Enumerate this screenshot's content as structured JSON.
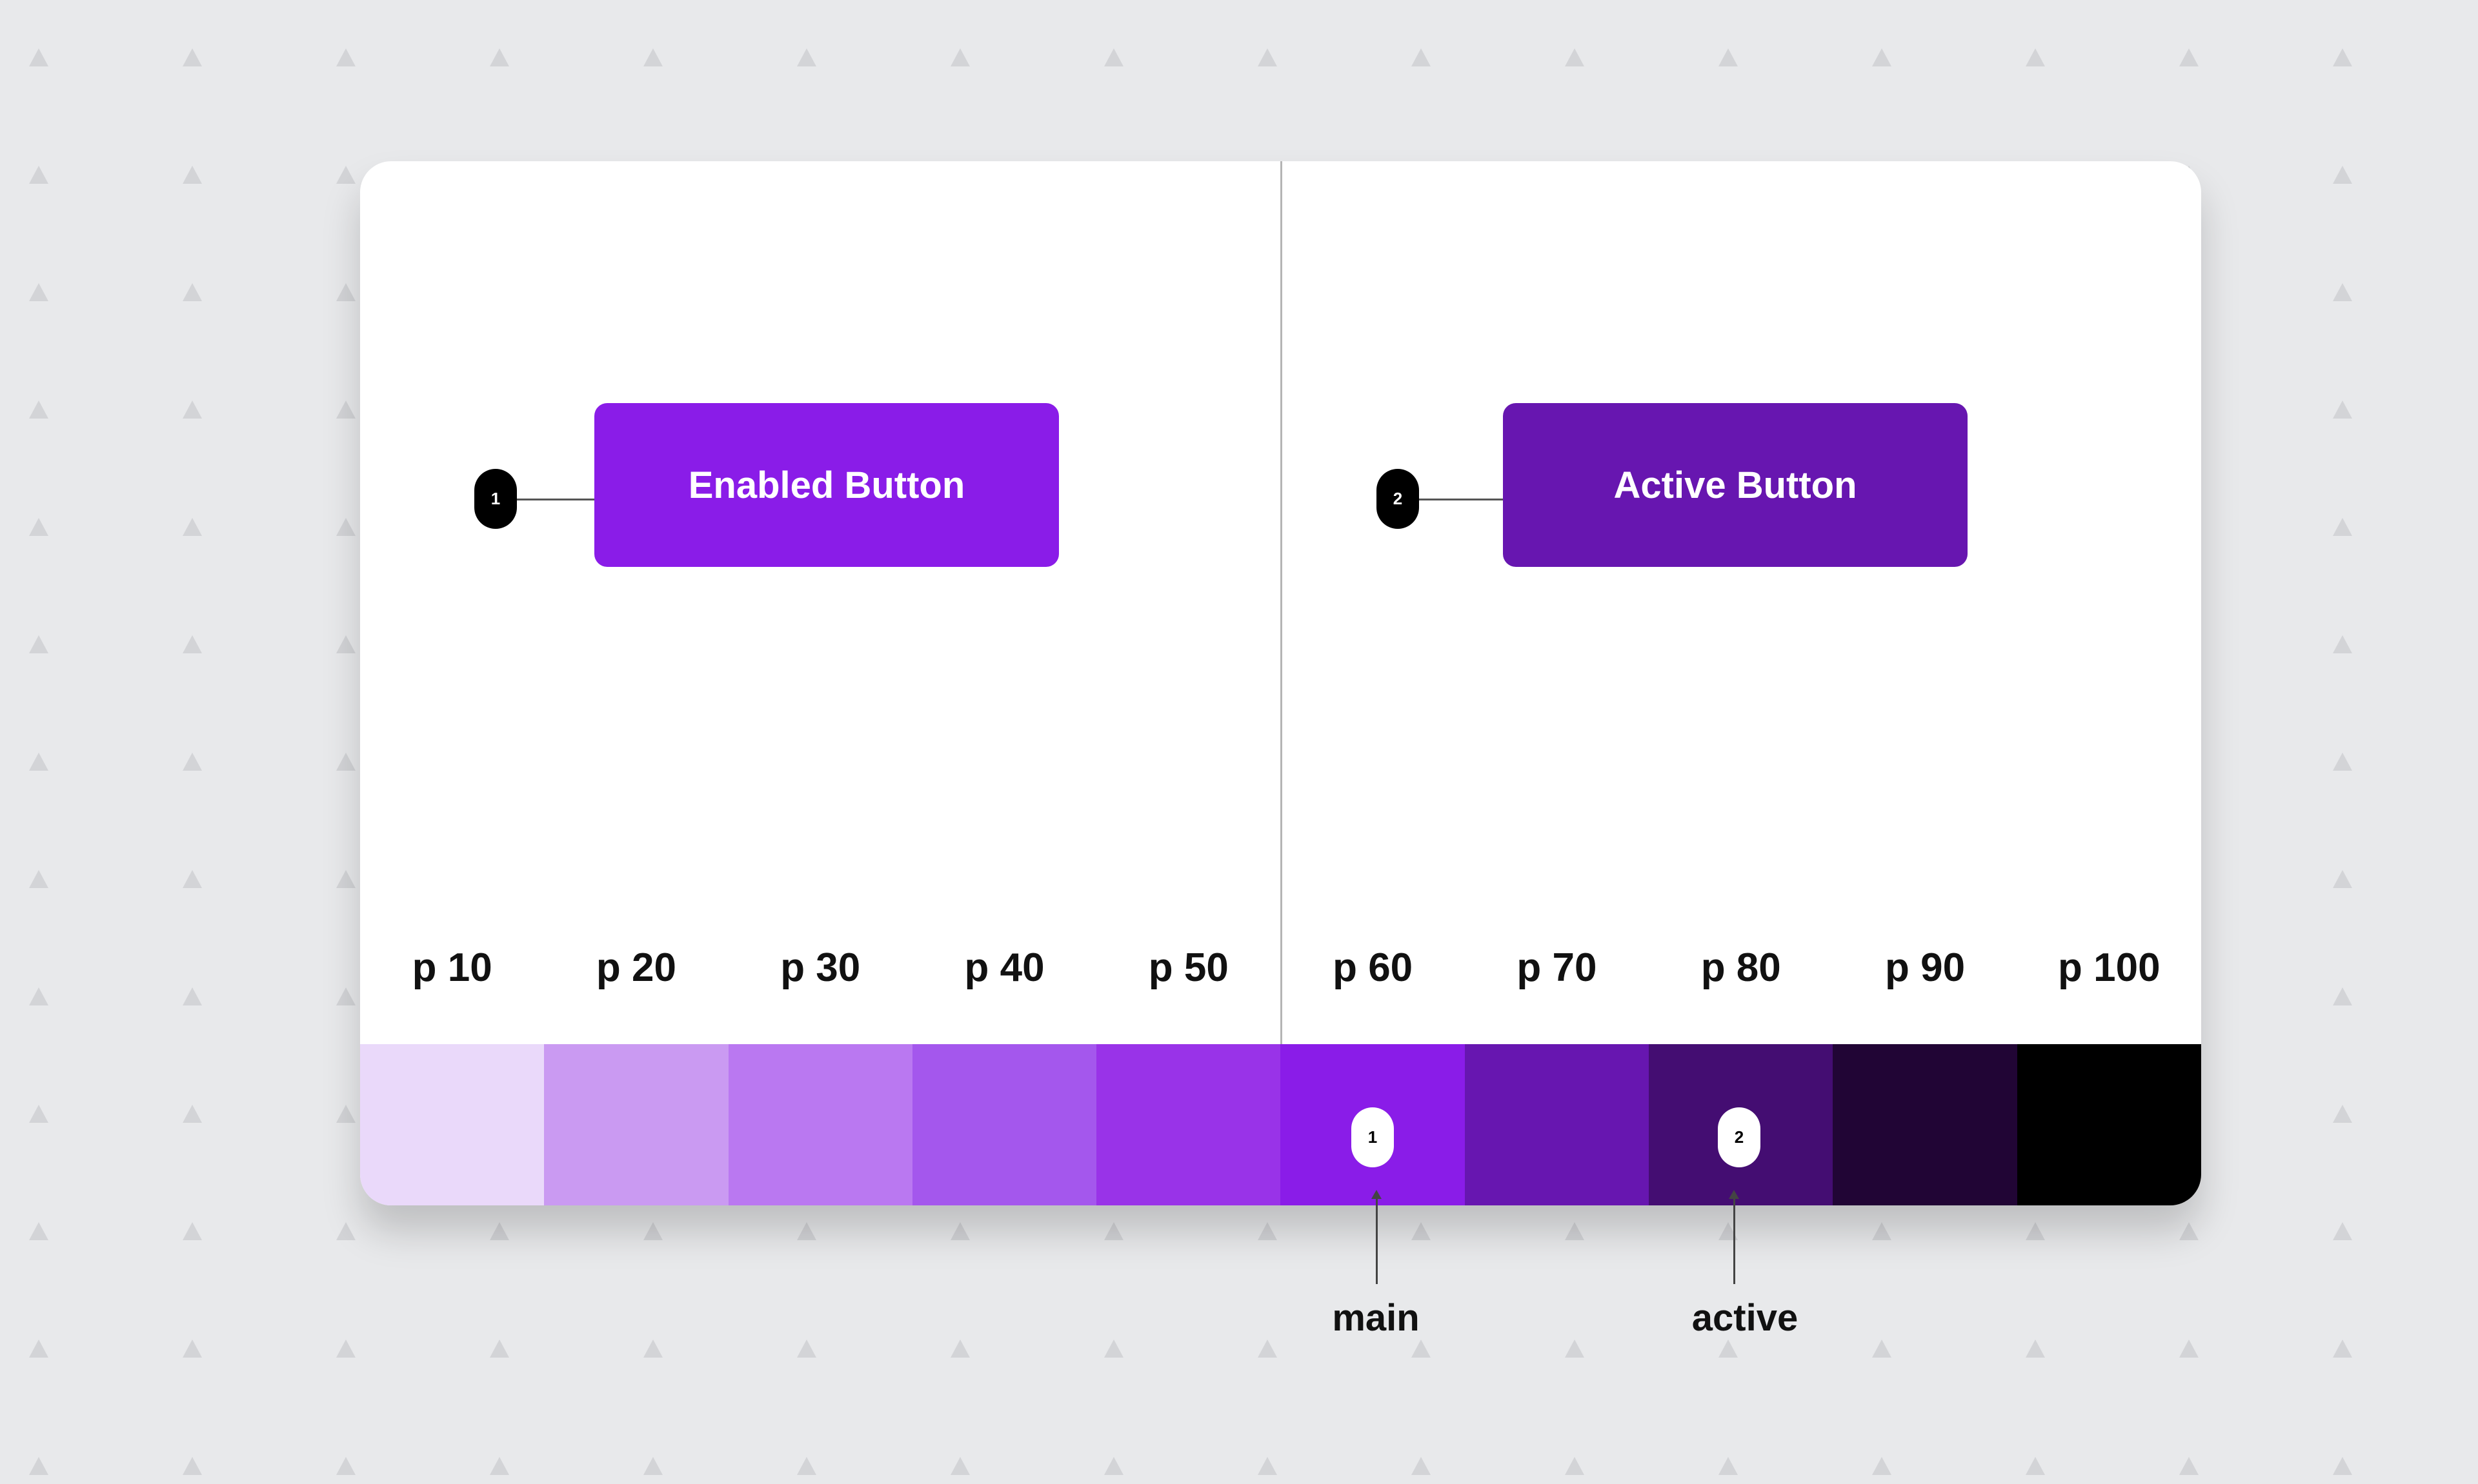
{
  "states": [
    {
      "badge": "1",
      "label": "Enabled Button",
      "color": "#8A1CE8"
    },
    {
      "badge": "2",
      "label": "Active Button",
      "color": "#6716B0"
    }
  ],
  "palette": [
    {
      "label": "p 10",
      "color": "#EAD9FA"
    },
    {
      "label": "p 20",
      "color": "#CA9AF2"
    },
    {
      "label": "p 30",
      "color": "#BA78F1"
    },
    {
      "label": "p 40",
      "color": "#A457ED"
    },
    {
      "label": "p 50",
      "color": "#9933E8"
    },
    {
      "label": "p 60",
      "color": "#8A1CE8"
    },
    {
      "label": "p 70",
      "color": "#6716B0"
    },
    {
      "label": "p 80",
      "color": "#440D72"
    },
    {
      "label": "p 90",
      "color": "#210535"
    },
    {
      "label": "p 100",
      "color": "#000000"
    }
  ],
  "annotations": [
    {
      "badge": "1",
      "label": "main"
    },
    {
      "badge": "2",
      "label": "active"
    }
  ],
  "background": {
    "color": "#E8E9EB",
    "pattern": "triangle"
  }
}
